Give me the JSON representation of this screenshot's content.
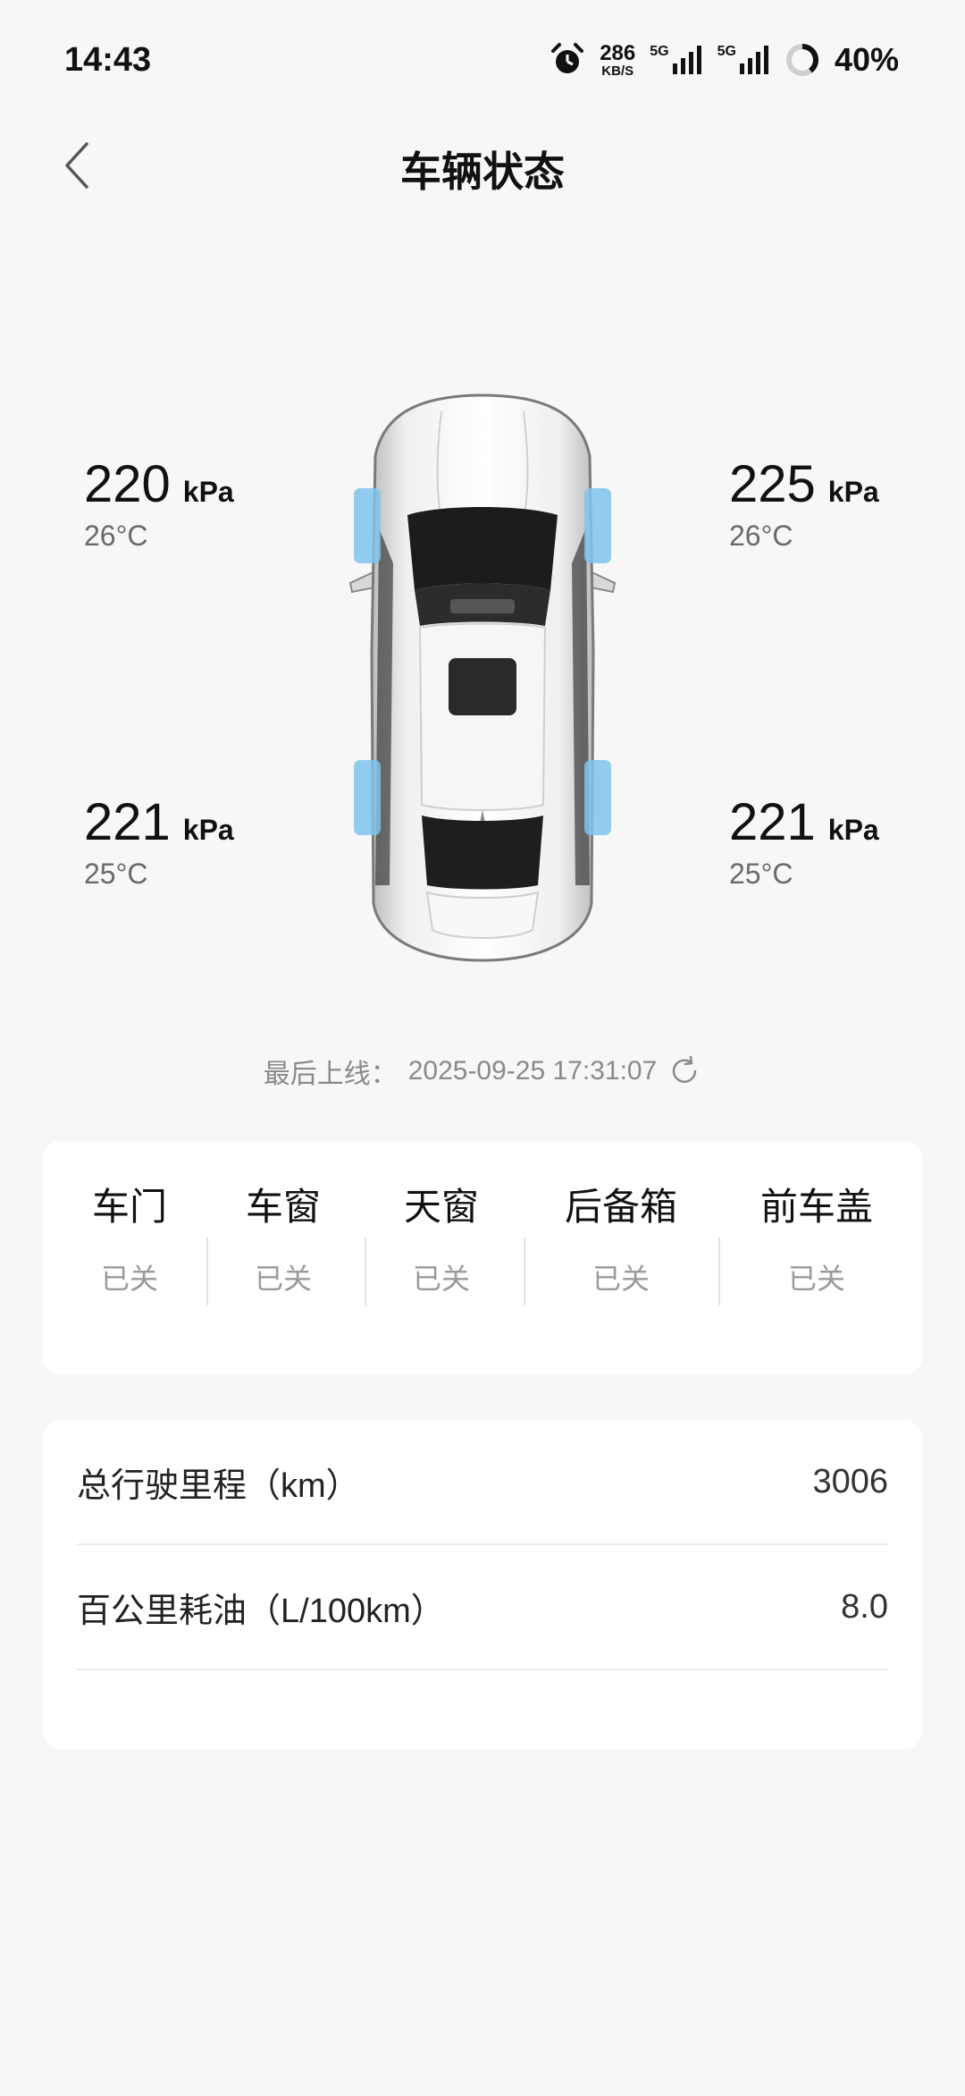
{
  "status_bar": {
    "time": "14:43",
    "net_speed_value": "286",
    "net_speed_unit": "KB/S",
    "signal1_tag": "5G",
    "signal2_tag": "5G",
    "battery_percent": "40%",
    "icons": [
      "alarm-icon",
      "signal-icon",
      "battery-ring-icon"
    ]
  },
  "header": {
    "title": "车辆状态",
    "back_icon": "chevron-left-icon"
  },
  "tires": {
    "front_left": {
      "pressure": "220",
      "unit": "kPa",
      "temp": "26°C"
    },
    "front_right": {
      "pressure": "225",
      "unit": "kPa",
      "temp": "26°C"
    },
    "rear_left": {
      "pressure": "221",
      "unit": "kPa",
      "temp": "25°C"
    },
    "rear_right": {
      "pressure": "221",
      "unit": "kPa",
      "temp": "25°C"
    },
    "highlight_color": "#7fc4ec"
  },
  "last_online": {
    "label": "最后上线：",
    "datetime": "2025-09-25 17:31:07",
    "icon": "refresh-icon"
  },
  "status_items": [
    {
      "label": "车门",
      "value": "已关"
    },
    {
      "label": "车窗",
      "value": "已关"
    },
    {
      "label": "天窗",
      "value": "已关"
    },
    {
      "label": "后备箱",
      "value": "已关"
    },
    {
      "label": "前车盖",
      "value": "已关"
    }
  ],
  "info": [
    {
      "label": "总行驶里程（km）",
      "value": "3006"
    },
    {
      "label": "百公里耗油（L/100km）",
      "value": "8.0"
    }
  ]
}
